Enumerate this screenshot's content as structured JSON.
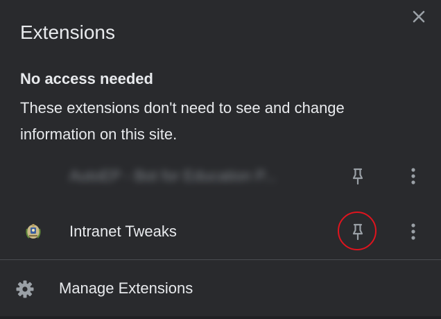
{
  "popup": {
    "title": "Extensions",
    "section": {
      "heading": "No access needed",
      "description": "These extensions don't need to see and change information on this site."
    },
    "extensions": [
      {
        "name": "AutoEP - Bot for Education P...",
        "blurred": true,
        "icon": "blank-extension-icon"
      },
      {
        "name": "Intranet Tweaks",
        "blurred": false,
        "icon": "crest-icon",
        "pin_highlighted": true
      }
    ],
    "footer": {
      "manage_label": "Manage Extensions",
      "icon": "gear-icon"
    }
  },
  "colors": {
    "background": "#292a2d",
    "text": "#e8eaed",
    "icon": "#9aa0a6",
    "highlight_circle": "#e0141e",
    "divider": "#4b4d51"
  }
}
